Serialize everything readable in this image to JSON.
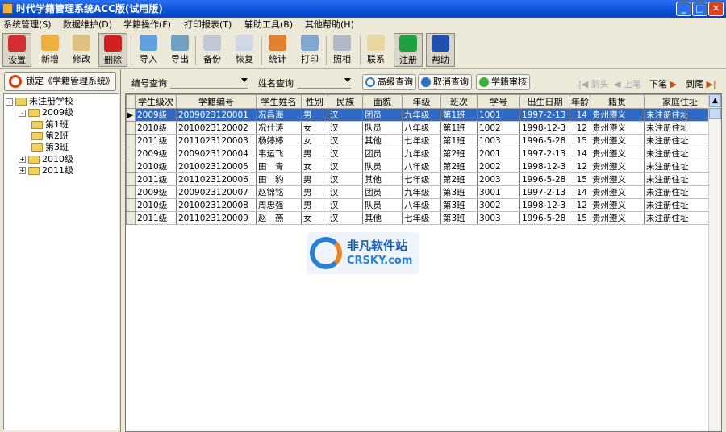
{
  "window": {
    "title": "时代学籍管理系统ACC版(试用版)",
    "min": "_",
    "max": "□",
    "close": "✕"
  },
  "menu": [
    "系统管理(S)",
    "数据维护(D)",
    "学籍操作(F)",
    "打印报表(T)",
    "辅助工具(B)",
    "其他帮助(H)"
  ],
  "toolbar": [
    {
      "label": "设置",
      "icon": "settings-icon",
      "color": "#d03030"
    },
    {
      "label": "新增",
      "icon": "add-icon",
      "color": "#f0b040"
    },
    {
      "label": "修改",
      "icon": "edit-icon",
      "color": "#e0c080"
    },
    {
      "label": "删除",
      "icon": "delete-icon",
      "color": "#d02020"
    },
    {
      "label": "导入",
      "icon": "import-icon",
      "color": "#60a0e0"
    },
    {
      "label": "导出",
      "icon": "export-icon",
      "color": "#70a0c0"
    },
    {
      "label": "备份",
      "icon": "backup-icon",
      "color": "#c0c8d8"
    },
    {
      "label": "恢复",
      "icon": "restore-icon",
      "color": "#d0d8e8"
    },
    {
      "label": "统计",
      "icon": "chart-icon",
      "color": "#e08030"
    },
    {
      "label": "打印",
      "icon": "print-icon",
      "color": "#80a8d0"
    },
    {
      "label": "照相",
      "icon": "camera-icon",
      "color": "#b0b8c8"
    },
    {
      "label": "联系",
      "icon": "mail-icon",
      "color": "#e8d8a0"
    },
    {
      "label": "注册",
      "icon": "register-icon",
      "color": "#20a040"
    },
    {
      "label": "帮助",
      "icon": "help-icon",
      "color": "#2050b0"
    }
  ],
  "left": {
    "lock_label": "锁定《学籍管理系统》",
    "tree": [
      {
        "label": "未注册学校",
        "level": 0,
        "pm": "-"
      },
      {
        "label": "2009级",
        "level": 1,
        "pm": "-"
      },
      {
        "label": "第1班",
        "level": 2
      },
      {
        "label": "第2班",
        "level": 2
      },
      {
        "label": "第3班",
        "level": 2
      },
      {
        "label": "2010级",
        "level": 1,
        "pm": "+"
      },
      {
        "label": "2011级",
        "level": 1,
        "pm": "+"
      }
    ]
  },
  "query": {
    "id_label": "编号查询",
    "id_value": "",
    "name_label": "姓名查询",
    "name_value": "",
    "advanced": "高级查询",
    "cancel": "取消查询",
    "audit": "学籍审核",
    "nav": {
      "first": "到头",
      "prev": "上笔",
      "next": "下笔",
      "last": "到尾"
    }
  },
  "table": {
    "columns": [
      "学生级次",
      "学籍编号",
      "学生姓名",
      "性别",
      "民族",
      "面貌",
      "年级",
      "班次",
      "学号",
      "出生日期",
      "年龄",
      "籍贯",
      "家庭住址"
    ],
    "rows": [
      [
        "2009级",
        "2009023120001",
        "况昌海",
        "男",
        "汉",
        "团员",
        "九年级",
        "第1班",
        "1001",
        "1997-2-13",
        "14",
        "贵州遵义",
        "未注册住址"
      ],
      [
        "2010级",
        "2010023120002",
        "况仕涛",
        "女",
        "汉",
        "队员",
        "八年级",
        "第1班",
        "1002",
        "1998-12-3",
        "12",
        "贵州遵义",
        "未注册住址"
      ],
      [
        "2011级",
        "2011023120003",
        "杨婷婷",
        "女",
        "汉",
        "其他",
        "七年级",
        "第1班",
        "1003",
        "1996-5-28",
        "15",
        "贵州遵义",
        "未注册住址"
      ],
      [
        "2009级",
        "2009023120004",
        "韦运飞",
        "男",
        "汉",
        "团员",
        "九年级",
        "第2班",
        "2001",
        "1997-2-13",
        "14",
        "贵州遵义",
        "未注册住址"
      ],
      [
        "2010级",
        "2010023120005",
        "田　青",
        "女",
        "汉",
        "队员",
        "八年级",
        "第2班",
        "2002",
        "1998-12-3",
        "12",
        "贵州遵义",
        "未注册住址"
      ],
      [
        "2011级",
        "2011023120006",
        "田　豹",
        "男",
        "汉",
        "其他",
        "七年级",
        "第2班",
        "2003",
        "1996-5-28",
        "15",
        "贵州遵义",
        "未注册住址"
      ],
      [
        "2009级",
        "2009023120007",
        "赵锦铭",
        "男",
        "汉",
        "团员",
        "九年级",
        "第3班",
        "3001",
        "1997-2-13",
        "14",
        "贵州遵义",
        "未注册住址"
      ],
      [
        "2010级",
        "2010023120008",
        "周忠强",
        "男",
        "汉",
        "队员",
        "八年级",
        "第3班",
        "3002",
        "1998-12-3",
        "12",
        "贵州遵义",
        "未注册住址"
      ],
      [
        "2011级",
        "2011023120009",
        "赵　燕",
        "女",
        "汉",
        "其他",
        "七年级",
        "第3班",
        "3003",
        "1996-5-28",
        "15",
        "贵州遵义",
        "未注册住址"
      ]
    ],
    "selected_row": 0
  },
  "watermark": {
    "cn": "非凡软件站",
    "en": "CRSKY.com"
  }
}
